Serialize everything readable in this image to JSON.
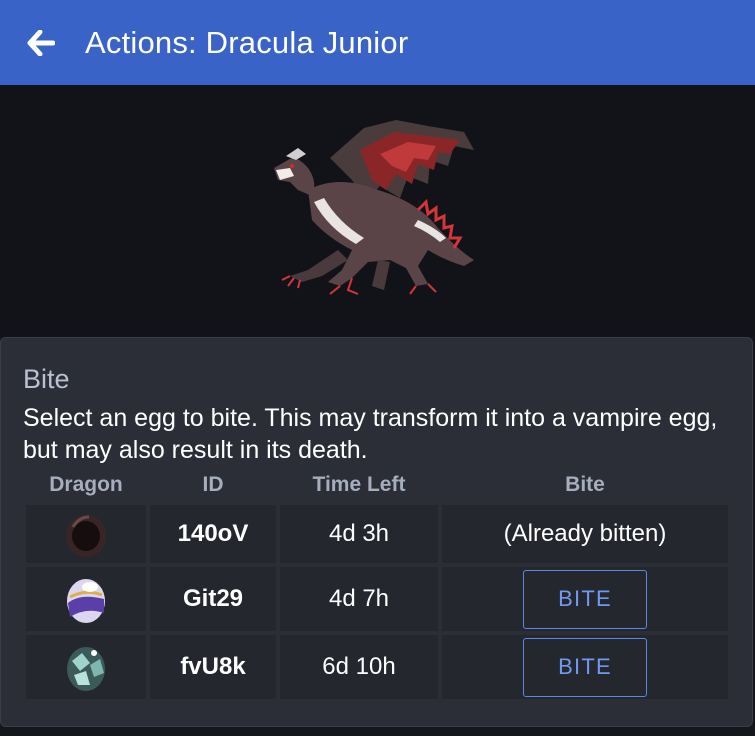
{
  "header": {
    "title": "Actions: Dracula Junior",
    "back_icon": "arrow-left-icon",
    "background": "#3a63c8"
  },
  "hero": {
    "image": "dragon-sprite",
    "background": "#121318"
  },
  "section": {
    "title": "Bite",
    "description": "Select an egg to bite. This may transform it into a vampire egg, but may also result in its death."
  },
  "table": {
    "columns": [
      "Dragon",
      "ID",
      "Time Left",
      "Bite"
    ],
    "rows": [
      {
        "egg": "dark-egg-icon",
        "id": "140oV",
        "time_left": "4d 3h",
        "bite": "(Already bitten)",
        "bite_action": false
      },
      {
        "egg": "purple-egg-icon",
        "id": "Git29",
        "time_left": "4d 7h",
        "bite": "BITE",
        "bite_action": true
      },
      {
        "egg": "crystal-egg-icon",
        "id": "fvU8k",
        "time_left": "6d 10h",
        "bite": "BITE",
        "bite_action": true
      }
    ]
  },
  "colors": {
    "accent": "#3a63c8",
    "button_outline": "#5b86e2",
    "panel": "#2b2e36",
    "cell": "#24272e"
  }
}
